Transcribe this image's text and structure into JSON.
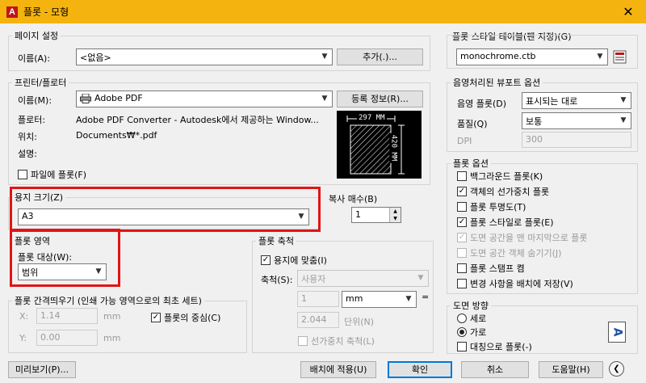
{
  "window": {
    "title": "플롯 - 모형",
    "app_icon_letter": "A",
    "close_glyph": "✕"
  },
  "page_setup": {
    "legend": "페이지 설정",
    "name_label": "이름(A):",
    "name_value": "<없음>",
    "add_button": "추가(.)..."
  },
  "printer": {
    "legend": "프린터/플로터",
    "name_label": "이름(M):",
    "name_value": "Adobe PDF",
    "properties_button": "등록 정보(R)...",
    "plotter_label": "플로터:",
    "plotter_value": "Adobe PDF Converter - Autodesk에서 제공하는 Window...",
    "where_label": "위치:",
    "where_value": "Documents₩*.pdf",
    "desc_label": "설명:",
    "plot_to_file": "파일에 플롯(F)",
    "preview_width": "297 MM",
    "preview_height": "420 MM"
  },
  "paper_size": {
    "legend": "용지 크기(Z)",
    "value": "A3"
  },
  "copies": {
    "legend": "복사 매수(B)",
    "value": "1"
  },
  "plot_area": {
    "legend": "플롯 영역",
    "what_label": "플롯 대상(W):",
    "what_value": "범위"
  },
  "plot_offset": {
    "legend": "플롯 간격띄우기 (인쇄 가능 영역으로의 최초 세트)",
    "x_label": "X:",
    "x_value": "1.14",
    "x_unit": "mm",
    "y_label": "Y:",
    "y_value": "0.00",
    "y_unit": "mm",
    "center_plot": "플롯의 중심(C)"
  },
  "plot_scale": {
    "legend": "플롯 축척",
    "fit_paper": "용지에 맞춤(I)",
    "scale_label": "축척(S):",
    "scale_value": "사용자",
    "value1": "1",
    "unit_value": "mm",
    "equals": "=",
    "value2": "2.044",
    "units_label": "단위(N)",
    "scale_lineweights": "선가중치 축척(L)"
  },
  "plot_style_table": {
    "legend": "플롯 스타일 테이블(펜 지정)(G)",
    "value": "monochrome.ctb"
  },
  "shaded_viewport": {
    "legend": "음영처리된 뷰포트 옵션",
    "shade_plot_label": "음영 플롯(D)",
    "shade_plot_value": "표시되는 대로",
    "quality_label": "품질(Q)",
    "quality_value": "보통",
    "dpi_label": "DPI",
    "dpi_value": "300"
  },
  "plot_options": {
    "legend": "플롯 옵션",
    "items": [
      {
        "label": "백그라운드 플롯(K)",
        "checked": false,
        "disabled": false
      },
      {
        "label": "객체의 선가중치 플롯",
        "checked": true,
        "disabled": false
      },
      {
        "label": "플롯 투명도(T)",
        "checked": false,
        "disabled": false
      },
      {
        "label": "플롯 스타일로 플롯(E)",
        "checked": true,
        "disabled": false
      },
      {
        "label": "도면 공간을 맨 마지막으로 플롯",
        "checked": true,
        "disabled": true
      },
      {
        "label": "도면 공간 객체 숨기기(J)",
        "checked": false,
        "disabled": true
      },
      {
        "label": "플롯 스탬프 켬",
        "checked": false,
        "disabled": false
      },
      {
        "label": "변경 사항을 배치에 저장(V)",
        "checked": false,
        "disabled": false
      }
    ]
  },
  "orientation": {
    "legend": "도면 방향",
    "portrait": "세로",
    "landscape": "가로",
    "upside_down": "대칭으로 플롯(-)",
    "icon_letter": "A"
  },
  "footer": {
    "preview": "미리보기(P)...",
    "apply_layout": "배치에 적용(U)",
    "ok": "확인",
    "cancel": "취소",
    "help": "도움말(H)",
    "collapse_glyph": "❮"
  },
  "colors": {
    "title_bar": "#f5b30f",
    "highlight_red": "#e21414",
    "accent_blue": "#0078d7"
  }
}
